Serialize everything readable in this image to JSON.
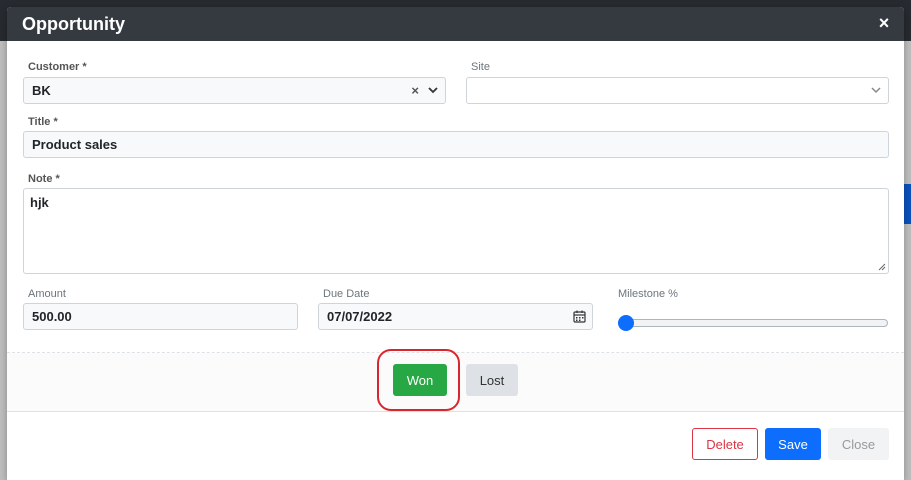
{
  "modal": {
    "title": "Opportunity",
    "close_symbol": "×"
  },
  "form": {
    "customer": {
      "label": "Customer *",
      "value": "BK",
      "clear_symbol": "×"
    },
    "site": {
      "label": "Site",
      "value": ""
    },
    "title": {
      "label": "Title *",
      "value": "Product sales"
    },
    "note": {
      "label": "Note *",
      "value": "hjk"
    },
    "amount": {
      "label": "Amount",
      "value": "500.00"
    },
    "due_date": {
      "label": "Due Date",
      "value": "07/07/2022"
    },
    "milestone": {
      "label": "Milestone %",
      "value_percent": 0
    }
  },
  "actions": {
    "won_label": "Won",
    "lost_label": "Lost",
    "delete_label": "Delete",
    "save_label": "Save",
    "close_label": "Close"
  },
  "colors": {
    "header_bg": "#343a40",
    "won": "#28a745",
    "save": "#0d6efd",
    "delete": "#dc3545",
    "highlight": "#d9262c"
  }
}
